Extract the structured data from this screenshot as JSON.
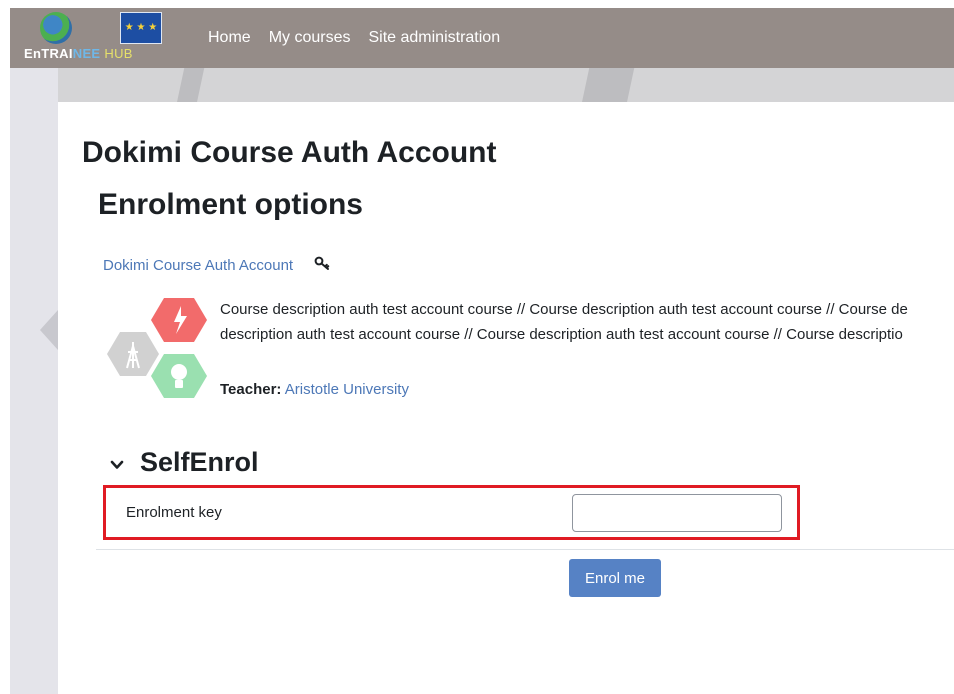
{
  "header": {
    "logo_text": {
      "part1": "EnTRAI",
      "part2": "NEE",
      "part3": "HUB"
    },
    "nav": [
      {
        "label": "Home"
      },
      {
        "label": "My courses"
      },
      {
        "label": "Site administration"
      }
    ]
  },
  "page": {
    "course_title": "Dokimi Course Auth Account",
    "section_title": "Enrolment options"
  },
  "course_box": {
    "link_text": "Dokimi Course Auth Account",
    "summary_line1": "Course description auth test account course // Course description auth test account course // Course de",
    "summary_line2": "description auth test account course // Course description auth test account course // Course descriptio",
    "teacher_label": "Teacher:",
    "teacher_name": "Aristotle University"
  },
  "selfenrol": {
    "title": "SelfEnrol",
    "key_label": "Enrolment key",
    "key_value": "",
    "button_label": "Enrol me"
  },
  "colors": {
    "topbar": "#958c88",
    "link": "#4d78b7",
    "button": "#5682c5",
    "highlight_border": "#e01b23"
  }
}
